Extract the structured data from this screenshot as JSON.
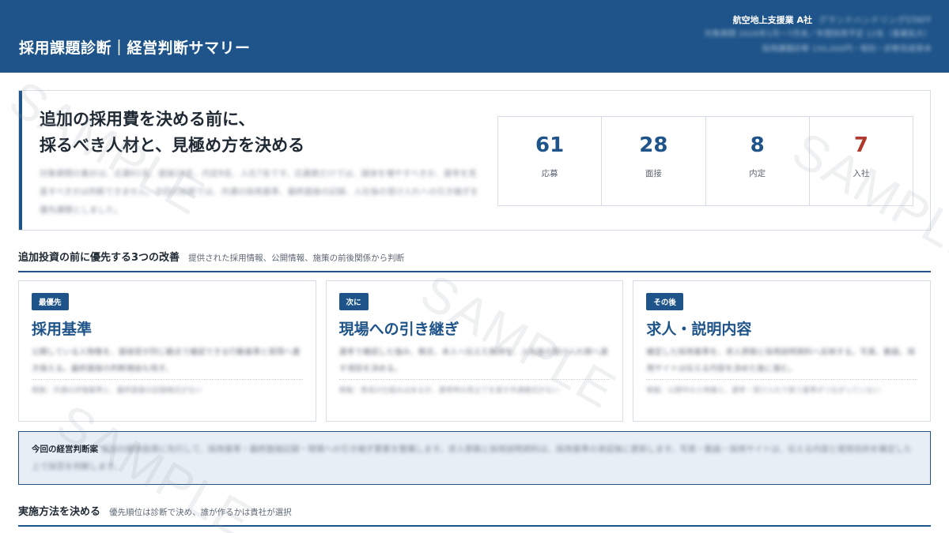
{
  "header": {
    "title": "採用課題診断｜経営判断サマリー",
    "company": "航空地上支援業 A社",
    "company_dept": "グランドハンドリングSTAFF",
    "period_line": "対象期間 2026年1月〜7月末／年間採用予定 12名（事業拡大）",
    "fee_line": "採用課題診断 150,000円・税別・診断完成資本"
  },
  "hero": {
    "headline_line1": "追加の採用費を決める前に、",
    "headline_line2": "採るべき人材と、見極め方を決める",
    "description": "対象期間の集計は、応募61名、面接28名、内定8名、入社7名です。応募数だけでは、媒体を増やすべきか、選考を見直すべきかは判断できません。今回の診断では、共通の採用基準、最終面接の記録、入社後の受け入れへの引き継ぎを優先課題としました。"
  },
  "stats": [
    {
      "value": "61",
      "label": "応募"
    },
    {
      "value": "28",
      "label": "面接"
    },
    {
      "value": "8",
      "label": "内定"
    },
    {
      "value": "7",
      "label": "入社"
    }
  ],
  "section1": {
    "title": "追加投資の前に優先する3つの改善",
    "subtitle": "提供された採用情報、公開情報、施策の前後関係から判断"
  },
  "cards": [
    {
      "badge": "最優先",
      "title": "採用基準",
      "desc": "公開している人物像を、面接官が同じ観点で確認できる行動基準と質問へ書き換える。最終面接の判断理由も残す。",
      "note": "根拠：共通の評価基準と、最終面接の記録様式がない"
    },
    {
      "badge": "次に",
      "title": "現場への引き継ぎ",
      "desc": "選考で確認した強み、懸念、本人へ伝えた期待を、入社後の受け入れ側へ渡す項目を決める。",
      "note": "根拠：育成の仕組みはあるが、選考時の見立てを渡す共通様式がない"
    },
    {
      "badge": "その後",
      "title": "求人・説明内容",
      "desc": "確定した採用基準を、求人原稿と採用説明資料へ反映する。写真、動画、採用サイトは伝える内容を決めた後に進む。",
      "note": "根拠：公開中の人物像と、選考・受け入れで使う基準がつながっていない"
    }
  ],
  "decision": {
    "label": "今回の経営判断案",
    "text": "追加の媒体投資に先行して、採用基準・最終面接記録・現場への引き継ぎ要素を整備します。求人原稿と採用説明資料は、採用基準の承認後に更新します。写真・動画・採用サイトは、伝える内容と使用目的を確定した上で採否を判断します。"
  },
  "section2": {
    "title": "実施方法を決める",
    "subtitle": "優先順位は診断で決め、誰が作るかは貴社が選択"
  },
  "watermark": "SAMPLE",
  "colors": {
    "brand": "#1e5489",
    "accent_red": "#b03a2e",
    "panel_bg": "#e8eef6"
  }
}
